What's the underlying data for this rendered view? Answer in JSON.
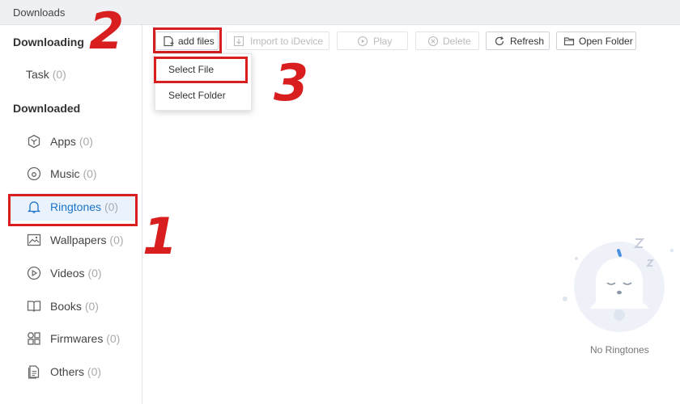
{
  "window": {
    "title": "Downloads"
  },
  "sidebar": {
    "downloading_heading": "Downloading",
    "downloaded_heading": "Downloaded",
    "task": {
      "label": "Task",
      "count": "(0)"
    },
    "items": [
      {
        "label": "Apps",
        "count": "(0)",
        "icon": "apps-icon"
      },
      {
        "label": "Music",
        "count": "(0)",
        "icon": "music-icon"
      },
      {
        "label": "Ringtones",
        "count": "(0)",
        "icon": "bell-icon",
        "active": true
      },
      {
        "label": "Wallpapers",
        "count": "(0)",
        "icon": "image-icon"
      },
      {
        "label": "Videos",
        "count": "(0)",
        "icon": "play-circle-icon"
      },
      {
        "label": "Books",
        "count": "(0)",
        "icon": "book-icon"
      },
      {
        "label": "Firmwares",
        "count": "(0)",
        "icon": "grid-icon"
      },
      {
        "label": "Others",
        "count": "(0)",
        "icon": "document-icon"
      }
    ]
  },
  "toolbar": {
    "add_files": "add files",
    "import_to_idevice": "Import to iDevice",
    "play": "Play",
    "delete": "Delete",
    "refresh": "Refresh",
    "open_folder": "Open Folder"
  },
  "add_menu": {
    "select_file": "Select File",
    "select_folder": "Select Folder"
  },
  "annotations": {
    "step1": "1",
    "step2": "2",
    "step3": "3"
  },
  "empty_state": {
    "label": "No Ringtones"
  },
  "colors": {
    "highlight": "#d81e1e",
    "active_text": "#1a73c9",
    "active_bg": "#eaf3fd"
  }
}
